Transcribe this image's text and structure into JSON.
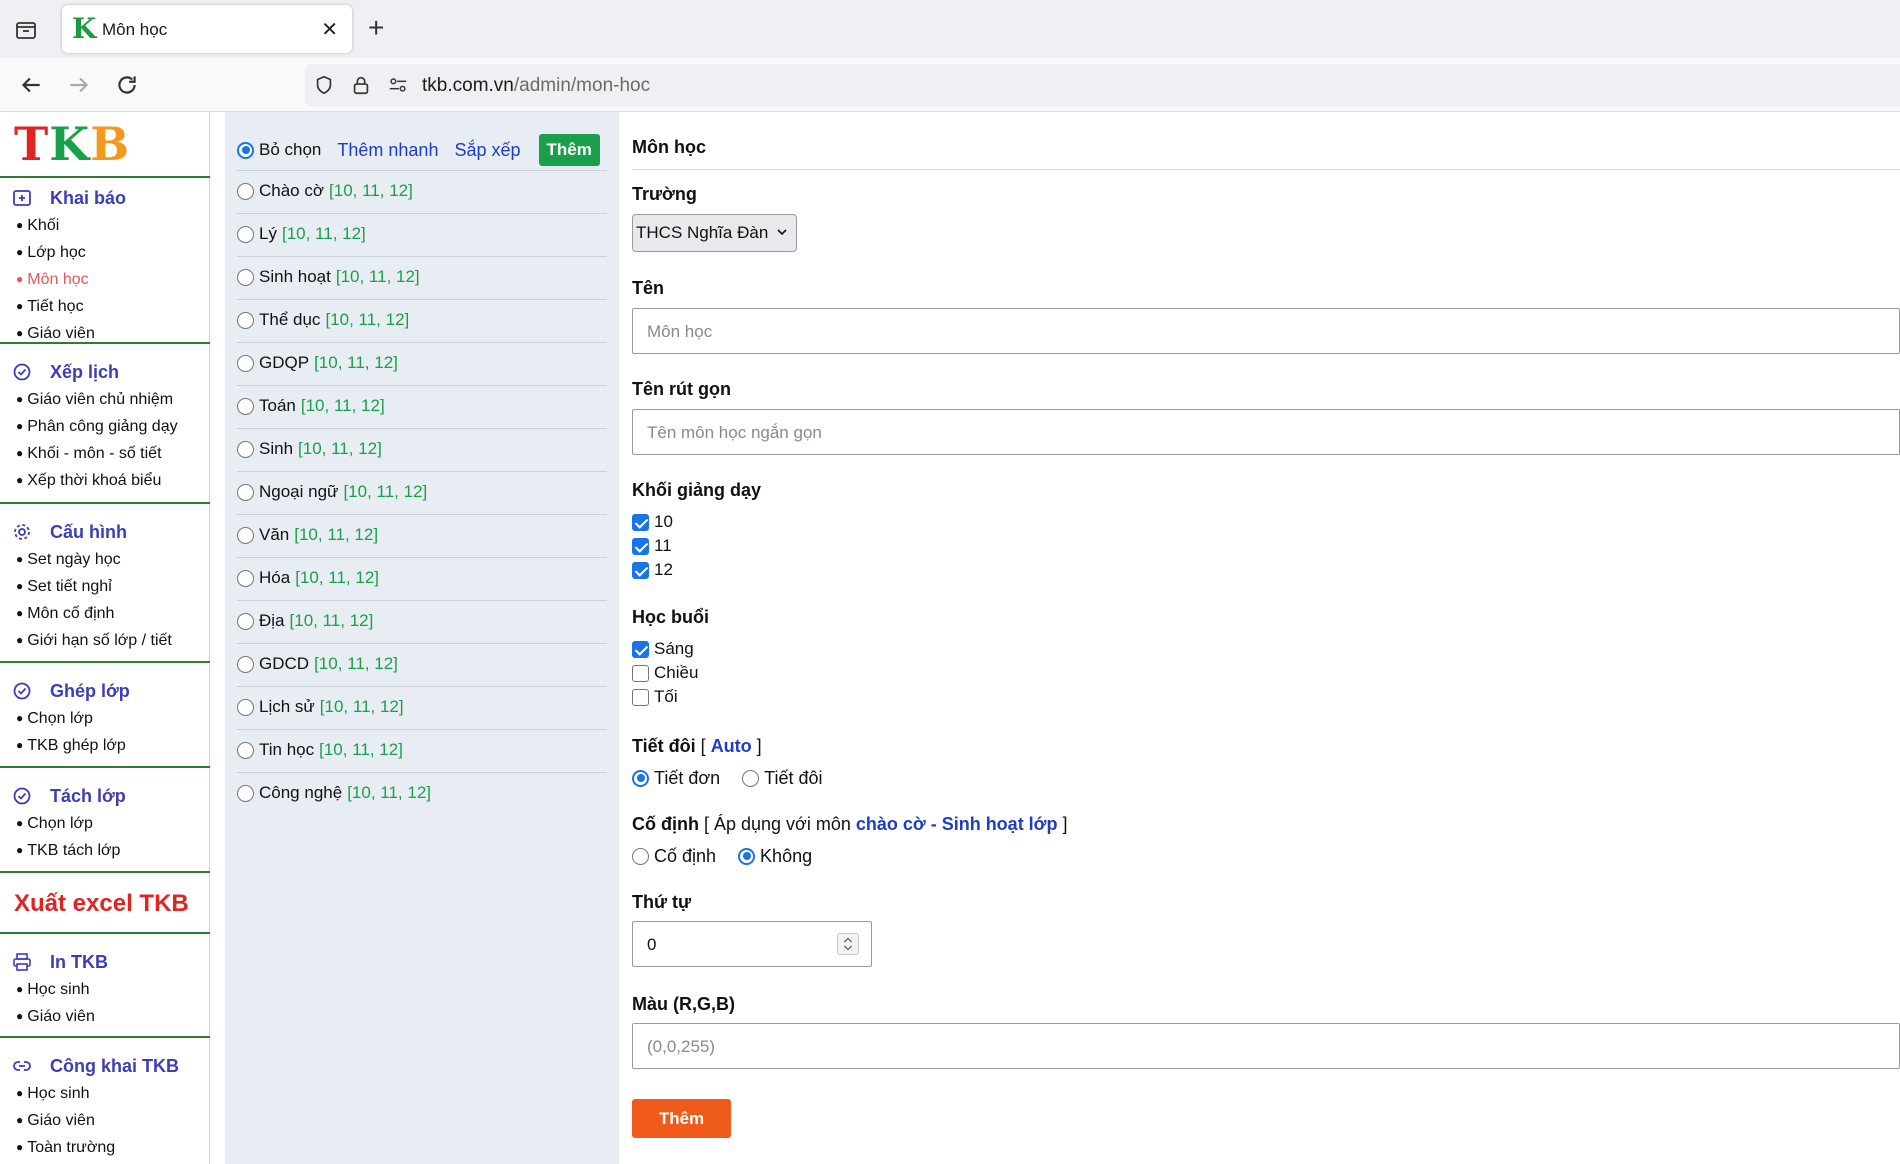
{
  "browser": {
    "tab_title": "Môn học",
    "tab_favicon": "K",
    "url_domain": "tkb.com.vn",
    "url_path": "/admin/mon-hoc"
  },
  "logo": {
    "t": "T",
    "k": "K",
    "b": "B"
  },
  "sidebar": {
    "khai_bao": {
      "title": "Khai báo",
      "icon": "plus-square-icon",
      "items": [
        "Khối",
        "Lớp học",
        "Môn học",
        "Tiết học",
        "Giáo viên"
      ]
    },
    "xep_lich": {
      "title": "Xếp lịch",
      "icon": "check-circle-icon",
      "items": [
        "Giáo viên chủ nhiệm",
        "Phân công giảng dạy",
        "Khối - môn - số tiết",
        "Xếp thời khoá biểu"
      ]
    },
    "cau_hinh": {
      "title": "Cấu hình",
      "icon": "gear-icon",
      "items": [
        "Set ngày học",
        "Set tiết nghỉ",
        "Môn cố định",
        "Giới hạn số lớp / tiết"
      ]
    },
    "ghep_lop": {
      "title": "Ghép lớp",
      "icon": "check-circle-icon",
      "items": [
        "Chọn lớp",
        "TKB ghép lớp"
      ]
    },
    "tach_lop": {
      "title": "Tách lớp",
      "icon": "check-circle-icon",
      "items": [
        "Chọn lớp",
        "TKB tách lớp"
      ]
    },
    "excel": "Xuất excel TKB",
    "in_tkb": {
      "title": "In TKB",
      "icon": "printer-icon",
      "items": [
        "Học sinh",
        "Giáo viên"
      ]
    },
    "cong_khai": {
      "title": "Công khai TKB",
      "icon": "link-icon",
      "items": [
        "Học sinh",
        "Giáo viên",
        "Toàn trường"
      ]
    }
  },
  "subject_list": {
    "deselect_label": "Bỏ chọn",
    "quick_add": "Thêm nhanh",
    "sort": "Sắp xếp",
    "add": "Thêm",
    "subjects": [
      {
        "name": "Chào cờ",
        "grades": "[10, 11, 12]"
      },
      {
        "name": "Lý",
        "grades": "[10, 11, 12]"
      },
      {
        "name": "Sinh hoạt",
        "grades": "[10, 11, 12]"
      },
      {
        "name": "Thể dục",
        "grades": "[10, 11, 12]"
      },
      {
        "name": "GDQP",
        "grades": "[10, 11, 12]"
      },
      {
        "name": "Toán",
        "grades": "[10, 11, 12]"
      },
      {
        "name": "Sinh",
        "grades": "[10, 11, 12]"
      },
      {
        "name": "Ngoại ngữ",
        "grades": "[10, 11, 12]"
      },
      {
        "name": "Văn",
        "grades": "[10, 11, 12]"
      },
      {
        "name": "Hóa",
        "grades": "[10, 11, 12]"
      },
      {
        "name": "Địa",
        "grades": "[10, 11, 12]"
      },
      {
        "name": "GDCD",
        "grades": "[10, 11, 12]"
      },
      {
        "name": "Lịch sử",
        "grades": "[10, 11, 12]"
      },
      {
        "name": "Tin học",
        "grades": "[10, 11, 12]"
      },
      {
        "name": "Công nghệ",
        "grades": "[10, 11, 12]"
      }
    ]
  },
  "form": {
    "title": "Môn học",
    "school_label": "Trường",
    "school_value": "THCS Nghĩa Đàn",
    "name_label": "Tên",
    "name_placeholder": "Môn học",
    "short_label": "Tên rút gọn",
    "short_placeholder": "Tên môn học ngắn gọn",
    "grades_label": "Khối giảng dạy",
    "grades": [
      {
        "label": "10",
        "checked": true
      },
      {
        "label": "11",
        "checked": true
      },
      {
        "label": "12",
        "checked": true
      }
    ],
    "session_label": "Học buổi",
    "sessions": [
      {
        "label": "Sáng",
        "checked": true
      },
      {
        "label": "Chiều",
        "checked": false
      },
      {
        "label": "Tối",
        "checked": false
      }
    ],
    "double_label": "Tiết đôi",
    "double_open": " [ ",
    "double_auto": "Auto",
    "double_close": " ]",
    "double_opts": [
      "Tiết đơn",
      "Tiết đôi"
    ],
    "double_selected": "Tiết đơn",
    "fixed_label": "Cố định",
    "fixed_note_pre": " [ Áp dụng với môn ",
    "fixed_note_link": "chào cờ - Sinh hoạt lớp",
    "fixed_note_post": " ]",
    "fixed_opts": [
      "Cố định",
      "Không"
    ],
    "fixed_selected": "Không",
    "order_label": "Thứ tự",
    "order_value": "0",
    "color_label": "Màu (R,G,B)",
    "color_placeholder": "(0,0,255)",
    "submit": "Thêm"
  },
  "colors": {
    "accent_blue": "#1e3cc8",
    "green": "#1aa04b",
    "orange": "#f05a1a",
    "red": "#e02424"
  }
}
